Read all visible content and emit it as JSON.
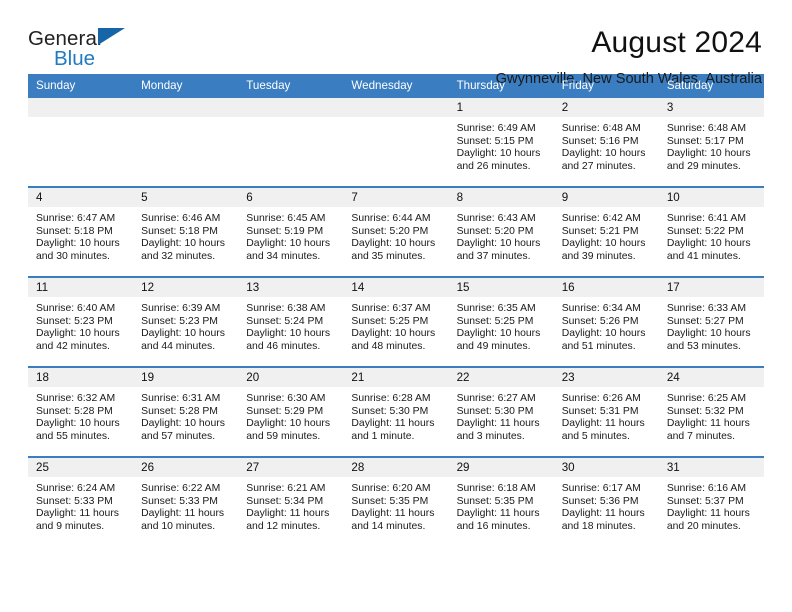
{
  "brand": {
    "name_part1": "General",
    "name_part2": "Blue",
    "logo_icon": "triangle-logo"
  },
  "header": {
    "title": "August 2024",
    "subtitle": "Gwynneville, New South Wales, Australia"
  },
  "theme": {
    "header_blue": "#3a7dc0",
    "brand_blue": "#1f7bc1",
    "daynum_band": "#f0f0f0"
  },
  "weekdays": [
    "Sunday",
    "Monday",
    "Tuesday",
    "Wednesday",
    "Thursday",
    "Friday",
    "Saturday"
  ],
  "weeks": [
    [
      {
        "day": "",
        "empty": true
      },
      {
        "day": "",
        "empty": true
      },
      {
        "day": "",
        "empty": true
      },
      {
        "day": "",
        "empty": true
      },
      {
        "day": "1",
        "sunrise": "Sunrise: 6:49 AM",
        "sunset": "Sunset: 5:15 PM",
        "daylight_line1": "Daylight: 10 hours",
        "daylight_line2": "and 26 minutes."
      },
      {
        "day": "2",
        "sunrise": "Sunrise: 6:48 AM",
        "sunset": "Sunset: 5:16 PM",
        "daylight_line1": "Daylight: 10 hours",
        "daylight_line2": "and 27 minutes."
      },
      {
        "day": "3",
        "sunrise": "Sunrise: 6:48 AM",
        "sunset": "Sunset: 5:17 PM",
        "daylight_line1": "Daylight: 10 hours",
        "daylight_line2": "and 29 minutes."
      }
    ],
    [
      {
        "day": "4",
        "sunrise": "Sunrise: 6:47 AM",
        "sunset": "Sunset: 5:18 PM",
        "daylight_line1": "Daylight: 10 hours",
        "daylight_line2": "and 30 minutes."
      },
      {
        "day": "5",
        "sunrise": "Sunrise: 6:46 AM",
        "sunset": "Sunset: 5:18 PM",
        "daylight_line1": "Daylight: 10 hours",
        "daylight_line2": "and 32 minutes."
      },
      {
        "day": "6",
        "sunrise": "Sunrise: 6:45 AM",
        "sunset": "Sunset: 5:19 PM",
        "daylight_line1": "Daylight: 10 hours",
        "daylight_line2": "and 34 minutes."
      },
      {
        "day": "7",
        "sunrise": "Sunrise: 6:44 AM",
        "sunset": "Sunset: 5:20 PM",
        "daylight_line1": "Daylight: 10 hours",
        "daylight_line2": "and 35 minutes."
      },
      {
        "day": "8",
        "sunrise": "Sunrise: 6:43 AM",
        "sunset": "Sunset: 5:20 PM",
        "daylight_line1": "Daylight: 10 hours",
        "daylight_line2": "and 37 minutes."
      },
      {
        "day": "9",
        "sunrise": "Sunrise: 6:42 AM",
        "sunset": "Sunset: 5:21 PM",
        "daylight_line1": "Daylight: 10 hours",
        "daylight_line2": "and 39 minutes."
      },
      {
        "day": "10",
        "sunrise": "Sunrise: 6:41 AM",
        "sunset": "Sunset: 5:22 PM",
        "daylight_line1": "Daylight: 10 hours",
        "daylight_line2": "and 41 minutes."
      }
    ],
    [
      {
        "day": "11",
        "sunrise": "Sunrise: 6:40 AM",
        "sunset": "Sunset: 5:23 PM",
        "daylight_line1": "Daylight: 10 hours",
        "daylight_line2": "and 42 minutes."
      },
      {
        "day": "12",
        "sunrise": "Sunrise: 6:39 AM",
        "sunset": "Sunset: 5:23 PM",
        "daylight_line1": "Daylight: 10 hours",
        "daylight_line2": "and 44 minutes."
      },
      {
        "day": "13",
        "sunrise": "Sunrise: 6:38 AM",
        "sunset": "Sunset: 5:24 PM",
        "daylight_line1": "Daylight: 10 hours",
        "daylight_line2": "and 46 minutes."
      },
      {
        "day": "14",
        "sunrise": "Sunrise: 6:37 AM",
        "sunset": "Sunset: 5:25 PM",
        "daylight_line1": "Daylight: 10 hours",
        "daylight_line2": "and 48 minutes."
      },
      {
        "day": "15",
        "sunrise": "Sunrise: 6:35 AM",
        "sunset": "Sunset: 5:25 PM",
        "daylight_line1": "Daylight: 10 hours",
        "daylight_line2": "and 49 minutes."
      },
      {
        "day": "16",
        "sunrise": "Sunrise: 6:34 AM",
        "sunset": "Sunset: 5:26 PM",
        "daylight_line1": "Daylight: 10 hours",
        "daylight_line2": "and 51 minutes."
      },
      {
        "day": "17",
        "sunrise": "Sunrise: 6:33 AM",
        "sunset": "Sunset: 5:27 PM",
        "daylight_line1": "Daylight: 10 hours",
        "daylight_line2": "and 53 minutes."
      }
    ],
    [
      {
        "day": "18",
        "sunrise": "Sunrise: 6:32 AM",
        "sunset": "Sunset: 5:28 PM",
        "daylight_line1": "Daylight: 10 hours",
        "daylight_line2": "and 55 minutes."
      },
      {
        "day": "19",
        "sunrise": "Sunrise: 6:31 AM",
        "sunset": "Sunset: 5:28 PM",
        "daylight_line1": "Daylight: 10 hours",
        "daylight_line2": "and 57 minutes."
      },
      {
        "day": "20",
        "sunrise": "Sunrise: 6:30 AM",
        "sunset": "Sunset: 5:29 PM",
        "daylight_line1": "Daylight: 10 hours",
        "daylight_line2": "and 59 minutes."
      },
      {
        "day": "21",
        "sunrise": "Sunrise: 6:28 AM",
        "sunset": "Sunset: 5:30 PM",
        "daylight_line1": "Daylight: 11 hours",
        "daylight_line2": "and 1 minute."
      },
      {
        "day": "22",
        "sunrise": "Sunrise: 6:27 AM",
        "sunset": "Sunset: 5:30 PM",
        "daylight_line1": "Daylight: 11 hours",
        "daylight_line2": "and 3 minutes."
      },
      {
        "day": "23",
        "sunrise": "Sunrise: 6:26 AM",
        "sunset": "Sunset: 5:31 PM",
        "daylight_line1": "Daylight: 11 hours",
        "daylight_line2": "and 5 minutes."
      },
      {
        "day": "24",
        "sunrise": "Sunrise: 6:25 AM",
        "sunset": "Sunset: 5:32 PM",
        "daylight_line1": "Daylight: 11 hours",
        "daylight_line2": "and 7 minutes."
      }
    ],
    [
      {
        "day": "25",
        "sunrise": "Sunrise: 6:24 AM",
        "sunset": "Sunset: 5:33 PM",
        "daylight_line1": "Daylight: 11 hours",
        "daylight_line2": "and 9 minutes."
      },
      {
        "day": "26",
        "sunrise": "Sunrise: 6:22 AM",
        "sunset": "Sunset: 5:33 PM",
        "daylight_line1": "Daylight: 11 hours",
        "daylight_line2": "and 10 minutes."
      },
      {
        "day": "27",
        "sunrise": "Sunrise: 6:21 AM",
        "sunset": "Sunset: 5:34 PM",
        "daylight_line1": "Daylight: 11 hours",
        "daylight_line2": "and 12 minutes."
      },
      {
        "day": "28",
        "sunrise": "Sunrise: 6:20 AM",
        "sunset": "Sunset: 5:35 PM",
        "daylight_line1": "Daylight: 11 hours",
        "daylight_line2": "and 14 minutes."
      },
      {
        "day": "29",
        "sunrise": "Sunrise: 6:18 AM",
        "sunset": "Sunset: 5:35 PM",
        "daylight_line1": "Daylight: 11 hours",
        "daylight_line2": "and 16 minutes."
      },
      {
        "day": "30",
        "sunrise": "Sunrise: 6:17 AM",
        "sunset": "Sunset: 5:36 PM",
        "daylight_line1": "Daylight: 11 hours",
        "daylight_line2": "and 18 minutes."
      },
      {
        "day": "31",
        "sunrise": "Sunrise: 6:16 AM",
        "sunset": "Sunset: 5:37 PM",
        "daylight_line1": "Daylight: 11 hours",
        "daylight_line2": "and 20 minutes."
      }
    ]
  ]
}
